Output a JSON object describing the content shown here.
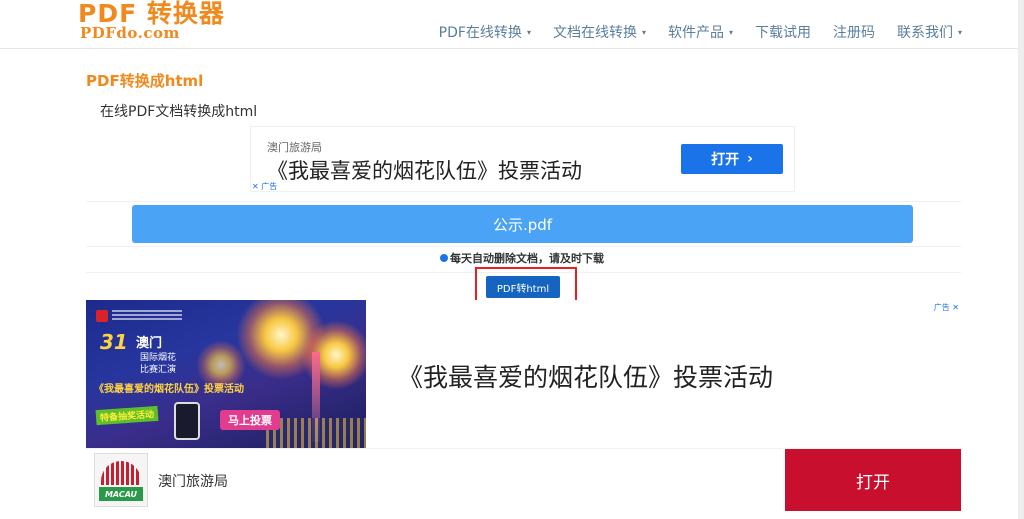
{
  "header": {
    "logo_title": "PDF 转换器",
    "logo_sub": "PDFdo.com",
    "nav": [
      {
        "label": "PDF在线转换",
        "dropdown": true
      },
      {
        "label": "文档在线转换",
        "dropdown": true
      },
      {
        "label": "软件产品",
        "dropdown": true
      },
      {
        "label": "下载试用",
        "dropdown": false
      },
      {
        "label": "注册码",
        "dropdown": false
      },
      {
        "label": "联系我们",
        "dropdown": true
      }
    ],
    "caret": "▾"
  },
  "main": {
    "title": "PDF转换成html",
    "subtitle": "在线PDF文档转换成html",
    "file_name": "公示.pdf",
    "notice": "每天自动删除文档，请及时下载",
    "convert_button": "PDF转html"
  },
  "ad1": {
    "advertiser": "澳门旅游局",
    "text": "《我最喜爱的烟花队伍》投票活动",
    "button": "打开",
    "button_icon": "›",
    "mark": "✕ 广告"
  },
  "ad2": {
    "mark": "广告 ✕",
    "text": "《我最喜爱的烟花队伍》投票活动",
    "image": {
      "number": "31",
      "city": "澳门",
      "line1": "国际烟花",
      "line2": "比赛汇演",
      "headline": "《我最喜爱的烟花队伍》投票活动",
      "tag": "特备抽奖活动",
      "vote": "马上投票"
    },
    "advertiser": "澳门旅游局",
    "logo_text": "MACAU",
    "button": "打开"
  },
  "colors": {
    "brand_orange": "#f08a1e",
    "nav_text": "#5b7f9b",
    "file_bar": "#4aa3f5",
    "convert_button": "#1565c0",
    "highlight_box": "#e52222",
    "ad_open_blue": "#1a73e8",
    "ad_open_red": "#c8102e"
  }
}
